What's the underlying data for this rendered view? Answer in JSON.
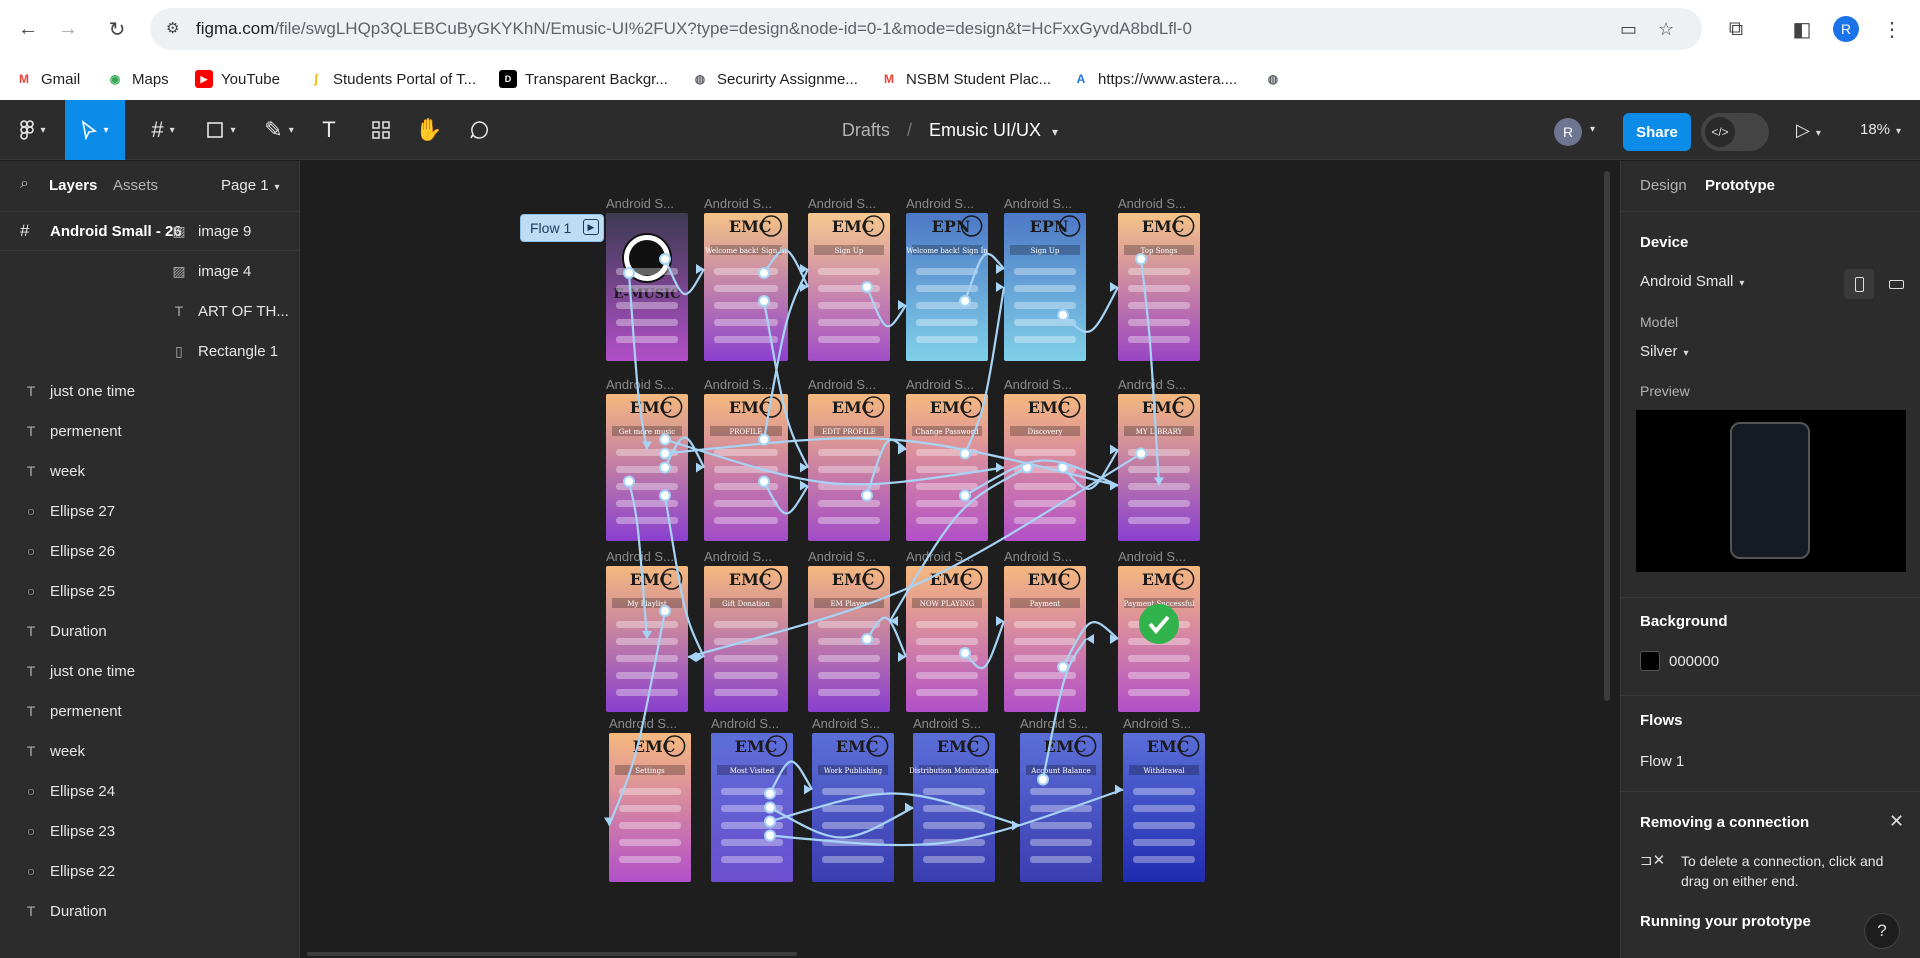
{
  "browser": {
    "url_main": "figma.com",
    "url_rest": "/file/swgLHQp3QLEBCuByGKYKhN/Emusic-UI%2FUX?type=design&node-id=0-1&mode=design&t=HcFxxGyvdA8bdLfl-0",
    "profile_initial": "R",
    "bookmarks": [
      {
        "label": "Gmail",
        "icon": "gmail-icon",
        "color": "#ea4335",
        "glyph": "M"
      },
      {
        "label": "Maps",
        "icon": "maps-pin-icon",
        "color": "#34a853",
        "glyph": "◉"
      },
      {
        "label": "YouTube",
        "icon": "youtube-icon",
        "color": "#ff0000",
        "glyph": "▶"
      },
      {
        "label": "Students Portal of T...",
        "icon": "portal-icon",
        "color": "#f2b600",
        "glyph": "ʃ"
      },
      {
        "label": "Transparent Backgr...",
        "icon": "dev-icon",
        "color": "#000000",
        "glyph": "D"
      },
      {
        "label": "Securirty Assignme...",
        "icon": "globe-icon",
        "color": "#5f6368",
        "glyph": "◍"
      },
      {
        "label": "NSBM Student Plac...",
        "icon": "gmail-icon",
        "color": "#ea4335",
        "glyph": "M"
      },
      {
        "label": "https://www.astera....",
        "icon": "astera-icon",
        "color": "#1a73e8",
        "glyph": "A"
      },
      {
        "label": "",
        "icon": "globe-icon",
        "color": "#5f6368",
        "glyph": "◍"
      }
    ]
  },
  "toolbar": {
    "drafts": "Drafts",
    "separator": "/",
    "file_name": "Emusic UI/UX",
    "user_initial": "R",
    "share_label": "Share",
    "zoom": "18%"
  },
  "left_panel": {
    "tab_layers": "Layers",
    "tab_assets": "Assets",
    "page": "Page 1",
    "selected_frame": "Android Small - 26",
    "layers": [
      {
        "label": "image 9",
        "type": "image",
        "indent": 1
      },
      {
        "label": "image 4",
        "type": "image",
        "indent": 1
      },
      {
        "label": "ART OF TH...",
        "type": "text",
        "indent": 1
      },
      {
        "label": "Rectangle 1",
        "type": "rect",
        "indent": 1
      },
      {
        "label": "just one time",
        "type": "text",
        "indent": 0
      },
      {
        "label": "permenent",
        "type": "text",
        "indent": 0
      },
      {
        "label": "week",
        "type": "text",
        "indent": 0
      },
      {
        "label": "Ellipse 27",
        "type": "ellipse",
        "indent": 0
      },
      {
        "label": "Ellipse 26",
        "type": "ellipse",
        "indent": 0
      },
      {
        "label": "Ellipse 25",
        "type": "ellipse",
        "indent": 0
      },
      {
        "label": "Duration",
        "type": "text",
        "indent": 0
      },
      {
        "label": "just one time",
        "type": "text",
        "indent": 0
      },
      {
        "label": "permenent",
        "type": "text",
        "indent": 0
      },
      {
        "label": "week",
        "type": "text",
        "indent": 0
      },
      {
        "label": "Ellipse 24",
        "type": "ellipse",
        "indent": 0
      },
      {
        "label": "Ellipse 23",
        "type": "ellipse",
        "indent": 0
      },
      {
        "label": "Ellipse 22",
        "type": "ellipse",
        "indent": 0
      },
      {
        "label": "Duration",
        "type": "text",
        "indent": 0
      }
    ]
  },
  "canvas": {
    "flow_label": "Flow 1",
    "frame_label": "Android S...",
    "rows": [
      [
        {
          "title": "E-MUSIC",
          "subtitle": "",
          "top": "#3c3b52",
          "bottom": "#b24fc9"
        },
        {
          "title": "EMC",
          "subtitle": "Welcome back! Sign In",
          "top": "#f5c486",
          "bottom": "#8c3fcf"
        },
        {
          "title": "EMC",
          "subtitle": "Sign Up",
          "top": "#f7c98e",
          "bottom": "#a14ec7"
        },
        {
          "title": "EPN",
          "subtitle": "Welcome back! Sign In",
          "top": "#4d78c7",
          "bottom": "#7fd0e8"
        },
        {
          "title": "EPN",
          "subtitle": "Sign Up",
          "top": "#4d78c7",
          "bottom": "#7fd0e8"
        },
        {
          "title": "EMC",
          "subtitle": "Top Songs",
          "top": "#f5c486",
          "bottom": "#9a44c4"
        }
      ],
      [
        {
          "title": "EMC",
          "subtitle": "Get more music",
          "top": "#f5b97e",
          "bottom": "#8a3fcf"
        },
        {
          "title": "EMC",
          "subtitle": "PROFILE",
          "top": "#f5b97e",
          "bottom": "#a24cc7"
        },
        {
          "title": "EMC",
          "subtitle": "EDIT PROFILE",
          "top": "#f5b97e",
          "bottom": "#a24cc7"
        },
        {
          "title": "EMC",
          "subtitle": "Change Password",
          "top": "#f5b97e",
          "bottom": "#b24fc9"
        },
        {
          "title": "EMC",
          "subtitle": "Discovery",
          "top": "#f5b97e",
          "bottom": "#b24fc9"
        },
        {
          "title": "EMC",
          "subtitle": "MY LIBRARY",
          "top": "#f5b97e",
          "bottom": "#8a3fcf"
        }
      ],
      [
        {
          "title": "EMC",
          "subtitle": "My Playlist",
          "top": "#f5b97e",
          "bottom": "#8a3fcf"
        },
        {
          "title": "EMC",
          "subtitle": "Gift Donation",
          "top": "#f5b97e",
          "bottom": "#8a3fcf"
        },
        {
          "title": "EMC",
          "subtitle": "EM Player",
          "top": "#f5b97e",
          "bottom": "#8a3fcf"
        },
        {
          "title": "EMC",
          "subtitle": "NOW PLAYING",
          "top": "#f5b97e",
          "bottom": "#b24fc9"
        },
        {
          "title": "EMC",
          "subtitle": "Payment",
          "top": "#f5b97e",
          "bottom": "#b24fc9"
        },
        {
          "title": "EMC",
          "subtitle": "Payment Successful",
          "top": "#f5b97e",
          "bottom": "#b24fc9"
        }
      ],
      [
        {
          "title": "EMC",
          "subtitle": "Settings",
          "top": "#f5b97e",
          "bottom": "#b24fc9"
        },
        {
          "title": "EMC",
          "subtitle": "Most Visited",
          "top": "#5b6ed8",
          "bottom": "#6c4fd0"
        },
        {
          "title": "EMC",
          "subtitle": "Work Publishing",
          "top": "#5b6ed8",
          "bottom": "#3a3db0"
        },
        {
          "title": "EMC",
          "subtitle": "Distribution Monitization",
          "top": "#5b6ed8",
          "bottom": "#3a3db0"
        },
        {
          "title": "EMC",
          "subtitle": "Account Balance",
          "top": "#5b6ed8",
          "bottom": "#3a3db0"
        },
        {
          "title": "EMC",
          "subtitle": "Withdrawal",
          "top": "#5b6ed8",
          "bottom": "#1f2bb0"
        }
      ]
    ]
  },
  "right_panel": {
    "tab_design": "Design",
    "tab_prototype": "Prototype",
    "device_heading": "Device",
    "device_value": "Android Small",
    "model_label": "Model",
    "model_value": "Silver",
    "preview_label": "Preview",
    "background_heading": "Background",
    "background_value": "000000",
    "flows_heading": "Flows",
    "flow_item": "Flow 1",
    "notice_heading": "Removing a connection",
    "notice_text": "To delete a connection, click and drag on either end.",
    "running_heading": "Running your prototype"
  },
  "colors": {
    "accent": "#0c8ce9",
    "panel": "#2c2c2c",
    "canvas": "#1e1e1e",
    "connector": "#a7d3f5"
  }
}
